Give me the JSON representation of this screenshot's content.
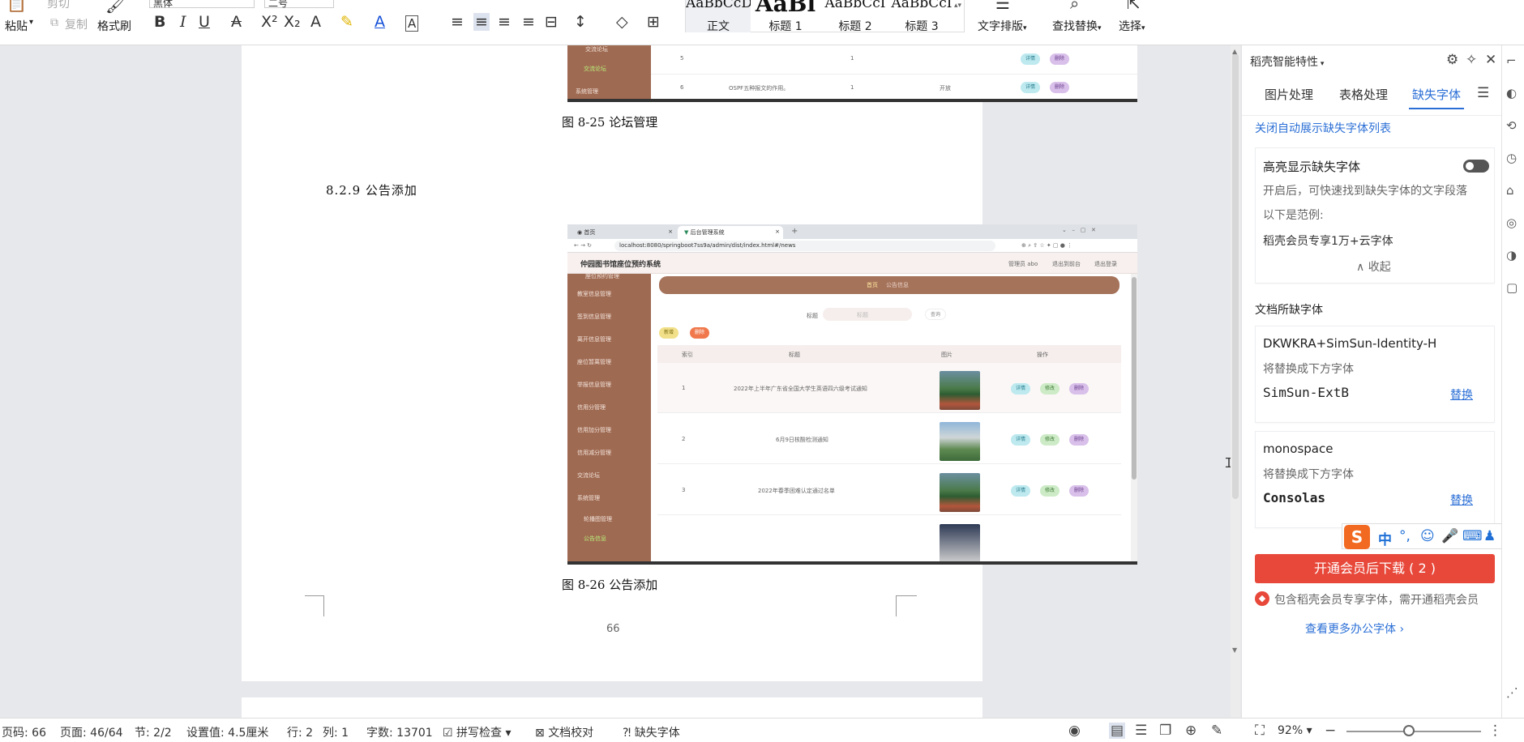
{
  "ribbon": {
    "paste": "粘贴",
    "cut": "剪切",
    "copy": "复制",
    "format_painter": "格式刷",
    "font_name": "黑体",
    "font_size": "二号",
    "styles": [
      "正文",
      "标题 1",
      "标题 2",
      "标题 3"
    ],
    "style_previews": [
      "AaBbCcDc",
      "AaBl",
      "AaBbCcI",
      "AaBbCcI"
    ],
    "text_layout": "文字排版",
    "find_replace": "查找替换",
    "select": "选择"
  },
  "document": {
    "shot1": {
      "side_items": [
        "交流论坛",
        "交流论坛",
        "系统管理"
      ],
      "rows": [
        {
          "idx": "5",
          "title": "",
          "count": "1",
          "status": ""
        },
        {
          "idx": "6",
          "title": "OSPF五种报文的作用。",
          "count": "1",
          "status": "开放"
        }
      ],
      "btn_detail": "详情",
      "btn_delete": "删除"
    },
    "caption1": "图 8-25 论坛管理",
    "heading": "8.2.9  公告添加",
    "shot2": {
      "tabs": [
        "首页",
        "后台管理系统"
      ],
      "url": "localhost:8080/springboot7ss9a/admin/dist/index.html#/news",
      "app_title": "仲园图书馆座位预约系统",
      "header_links": [
        "管理员 abo",
        "退出到前台",
        "退出登录"
      ],
      "side_items": [
        "座位预约管理",
        "教室信息管理",
        "签到信息管理",
        "离开信息管理",
        "座位暂离管理",
        "举报信息管理",
        "信用分管理",
        "信用加分管理",
        "信用减分管理",
        "交流论坛",
        "系统管理",
        "轮播图管理",
        "公告信息"
      ],
      "crumbs": [
        "首页",
        "公告信息"
      ],
      "search_label": "标题",
      "search_placeholder": "标题",
      "search_btn": "查询",
      "add_btn": "新增",
      "del_btn": "删除",
      "columns": [
        "索引",
        "标题",
        "图片",
        "操作"
      ],
      "rows": [
        {
          "idx": "1",
          "title": "2022年上半年广东省全国大学生英语四六级考试通知"
        },
        {
          "idx": "2",
          "title": "6月9日核酸检测通知"
        },
        {
          "idx": "3",
          "title": "2022年春季困难认定通过名单"
        }
      ],
      "btn_detail": "详情",
      "btn_edit": "修改",
      "btn_delete": "删除"
    },
    "caption2": "图 8-26 公告添加",
    "page_number": "66"
  },
  "panel": {
    "title": "稻壳智能特性",
    "tabs": [
      "图片处理",
      "表格处理",
      "缺失字体"
    ],
    "close_list_link": "关闭自动展示缺失字体列表",
    "highlight_title": "高亮显示缺失字体",
    "highlight_desc": "开启后，可快速找到缺失字体的文字段落",
    "example_label": "以下是范例:",
    "example_text": "稻壳会员专享1万+云字体",
    "collapse": "收起",
    "section_title": "文档所缺字体",
    "fonts": [
      {
        "missing": "DKWKRA+SimSun-Identity-H",
        "replace_hint": "将替换成下方字体",
        "replacement": "SimSun-ExtB",
        "action": "替换"
      },
      {
        "missing": "monospace",
        "replace_hint": "将替换成下方字体",
        "replacement": "Consolas",
        "action": "替换"
      }
    ],
    "download_btn": "开通会员后下载 ( 2 )",
    "member_note": "包含稻壳会员专享字体，需开通稻壳会员",
    "more_link": "查看更多办公字体"
  },
  "ime": {
    "logo": "S",
    "mode": "中"
  },
  "status": {
    "page_code": "页码: 66",
    "page": "页面: 46/64",
    "section": "节: 2/2",
    "setting": "设置值: 4.5厘米",
    "row": "行: 2",
    "col": "列: 1",
    "word_count": "字数: 13701",
    "spell_check": "拼写检查",
    "proofread": "文档校对",
    "missing_font": "缺失字体",
    "zoom": "92%"
  }
}
